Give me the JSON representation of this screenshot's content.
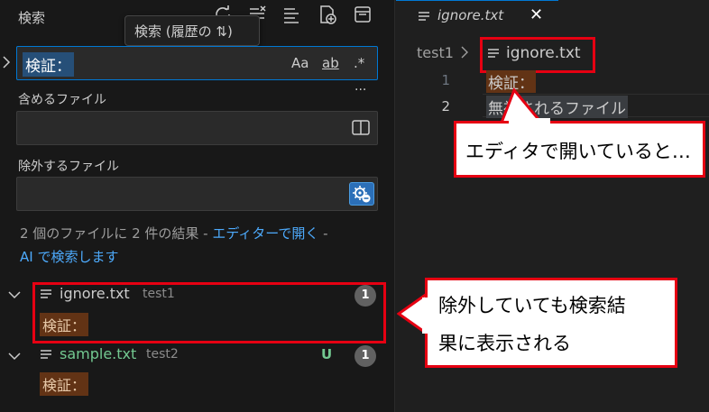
{
  "sidebar": {
    "title": "検索",
    "tooltip": "検索 (履歴の ⇅)",
    "search": {
      "value": "検証：",
      "options": [
        "Aa",
        "ab",
        ".*"
      ]
    },
    "more": "···",
    "include": {
      "label": "含めるファイル",
      "value": ""
    },
    "exclude": {
      "label": "除外するファイル",
      "value": ""
    },
    "results_message": {
      "prefix": "2 個のファイルに 2 件の結果 - ",
      "open_editor_link": "エディターで開く",
      "separator": " -",
      "ai_search_link": "AI で検索します"
    },
    "results": [
      {
        "file": "ignore.txt",
        "folder": "test1",
        "count": "1",
        "status": "",
        "match": "検証：",
        "file_color": "#cccccc"
      },
      {
        "file": "sample.txt",
        "folder": "test2",
        "count": "1",
        "status": "U",
        "match": "検証：",
        "file_color": "#73c991"
      }
    ]
  },
  "editor": {
    "tab": {
      "label": "ignore.txt",
      "close": "✕"
    },
    "breadcrumb": {
      "folder": "test1",
      "file": "ignore.txt"
    },
    "lines": [
      {
        "number": "1",
        "text": "検証："
      },
      {
        "number": "2",
        "text": "無視されるファイル"
      }
    ]
  },
  "annotations": {
    "editor_callout": "エディタで開いていると…",
    "results_callout_line1": "除外していても検索結",
    "results_callout_line2": "果に表示される"
  },
  "colors": {
    "accent": "#0078d4",
    "annotation_red": "#e60012",
    "match_highlight": "#623315",
    "untracked_green": "#73c991"
  }
}
